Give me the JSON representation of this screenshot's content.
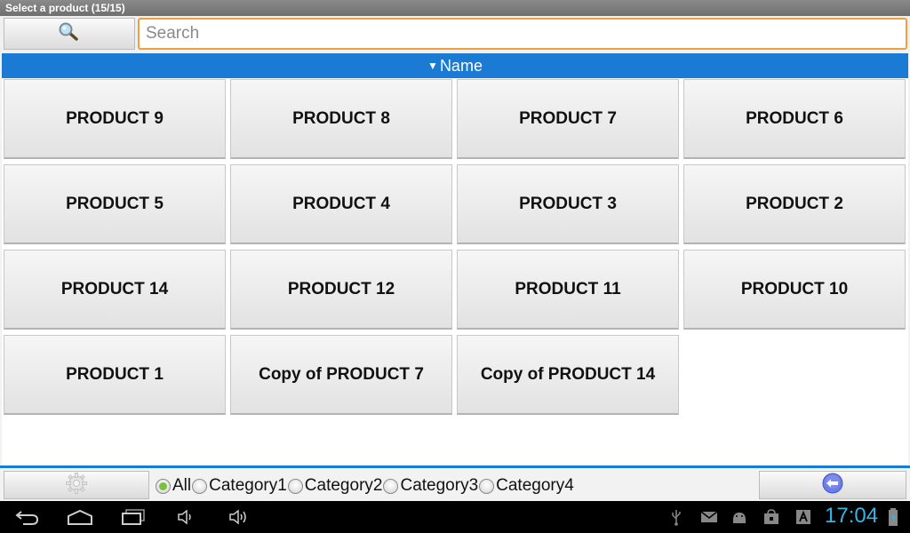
{
  "window": {
    "title": "Select a product (15/15)"
  },
  "search": {
    "placeholder": "Search",
    "value": "",
    "icon": "search-icon"
  },
  "sort": {
    "indicator": "▼",
    "label": "Name"
  },
  "products": [
    "PRODUCT 9",
    "PRODUCT 8",
    "PRODUCT 7",
    "PRODUCT 6",
    "PRODUCT 5",
    "PRODUCT 4",
    "PRODUCT 3",
    "PRODUCT 2",
    "PRODUCT 14",
    "PRODUCT 12",
    "PRODUCT 11",
    "PRODUCT 10",
    "PRODUCT 1",
    "Copy of PRODUCT 7",
    "Copy of PRODUCT 14"
  ],
  "filters": {
    "selected": "All",
    "options": [
      "All",
      "Category1",
      "Category2",
      "Category3",
      "Category4"
    ]
  },
  "bottom": {
    "settings_icon": "gear-icon",
    "back_icon": "back-arrow-icon"
  },
  "system_bar": {
    "time": "17:04",
    "nav_icons": [
      "back-icon",
      "home-icon",
      "recent-apps-icon",
      "volume-down-icon",
      "volume-up-icon"
    ],
    "status_icons": [
      "usb-icon",
      "email-icon",
      "android-debug-icon",
      "store-icon",
      "font-icon",
      "battery-icon"
    ]
  },
  "colors": {
    "accent": "#1a7ad4",
    "search_border": "#f0a040",
    "clock": "#33b5e5",
    "radio_selected": "#7ac23a"
  }
}
